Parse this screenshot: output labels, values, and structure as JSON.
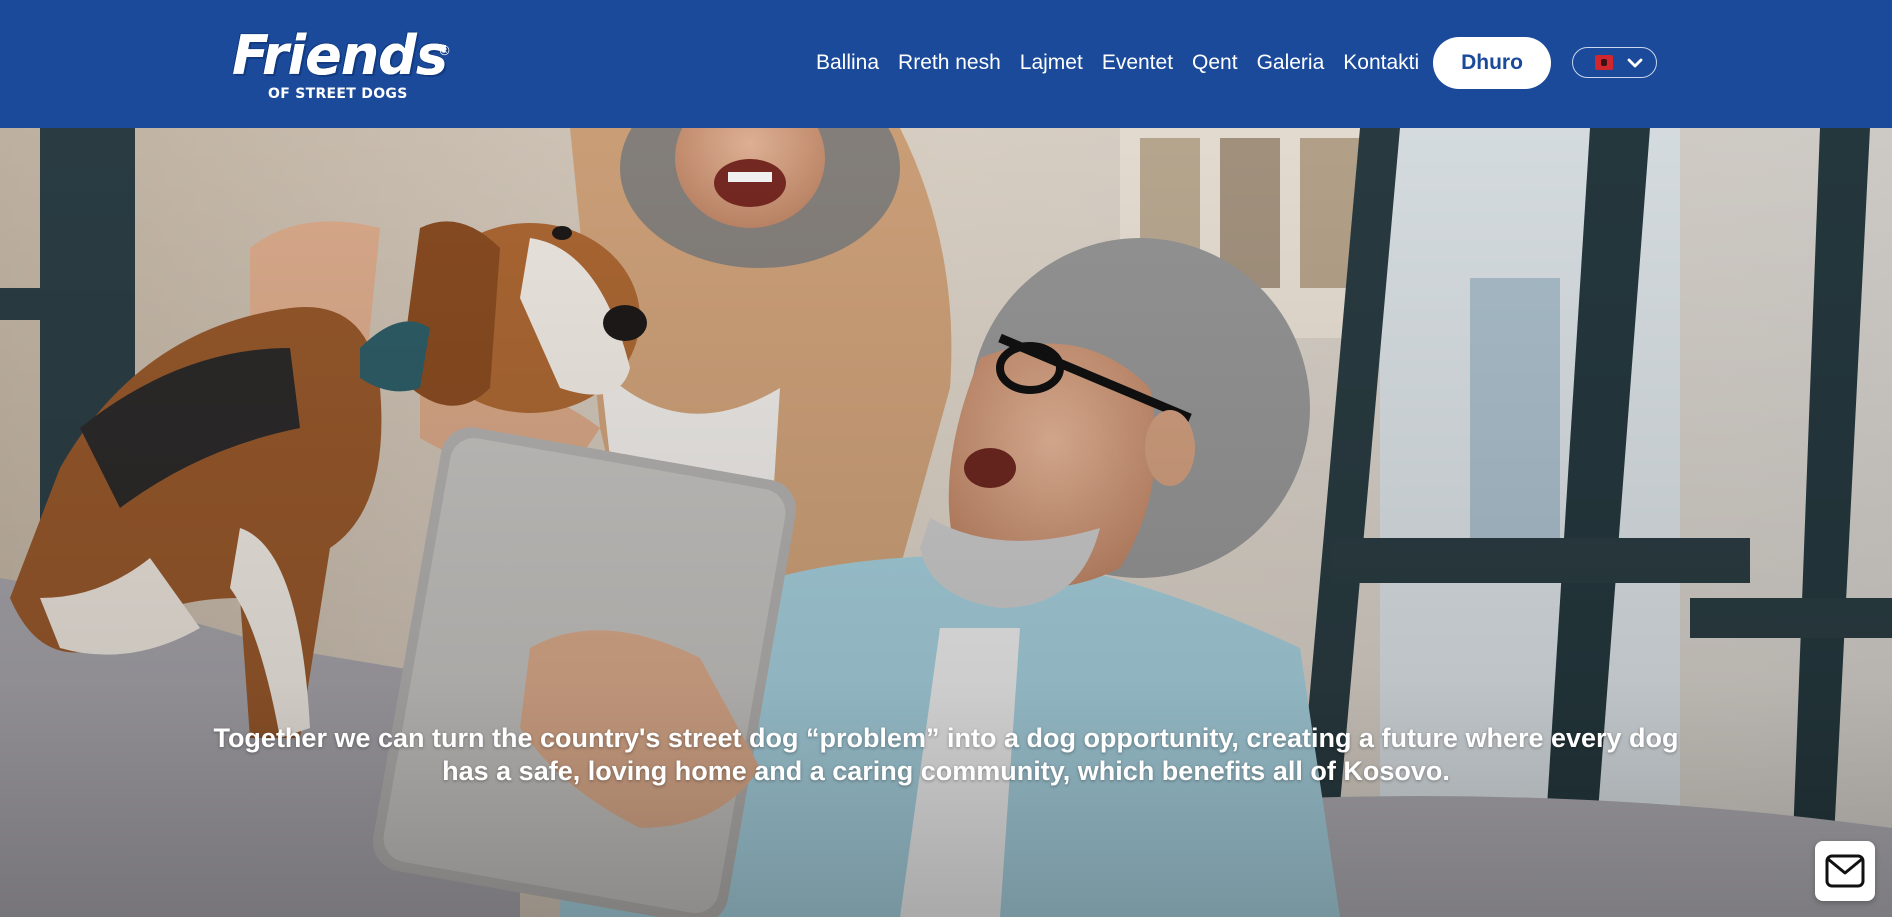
{
  "header": {
    "logo": {
      "word": "Friends",
      "registered": "®",
      "subtitle": "OF STREET DOGS"
    },
    "nav": [
      {
        "label": "Ballina"
      },
      {
        "label": "Rreth nesh"
      },
      {
        "label": "Lajmet"
      },
      {
        "label": "Eventet"
      },
      {
        "label": "Qent"
      },
      {
        "label": "Galeria"
      },
      {
        "label": "Kontakti"
      }
    ],
    "donate_label": "Dhuro",
    "language": {
      "icon": "albanian-flag-icon",
      "toggle_icon": "chevron-down-icon"
    }
  },
  "hero": {
    "image": "photo-couple-with-beagle-and-tablet",
    "tagline": "Together we can turn the country's street dog “problem” into a dog opportunity, creating a future where every dog has a safe, loving home and a caring community, which benefits all of Kosovo."
  },
  "contact_fab": {
    "icon": "envelope-icon"
  },
  "colors": {
    "brand_blue": "#1b4a9a",
    "white": "#ffffff"
  }
}
